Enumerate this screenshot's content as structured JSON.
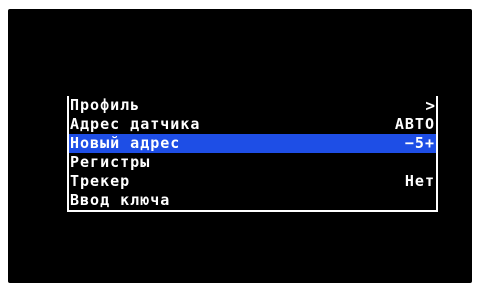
{
  "colors": {
    "screen_background": "#000000",
    "text": "#ffffff",
    "selection": "#1e4ee6"
  },
  "menu": {
    "items": [
      {
        "label": "Профиль",
        "value": "",
        "icon": "chevron-right-icon",
        "selected": false
      },
      {
        "label": "Адрес датчика",
        "value": "АВТО",
        "selected": false
      },
      {
        "label": "Новый адрес",
        "value": "−5+",
        "selected": true
      },
      {
        "label": "Регистры",
        "value": "",
        "selected": false
      },
      {
        "label": "Трекер",
        "value": "Нет",
        "selected": false
      },
      {
        "label": "Ввод ключа",
        "value": "",
        "selected": false
      }
    ]
  }
}
